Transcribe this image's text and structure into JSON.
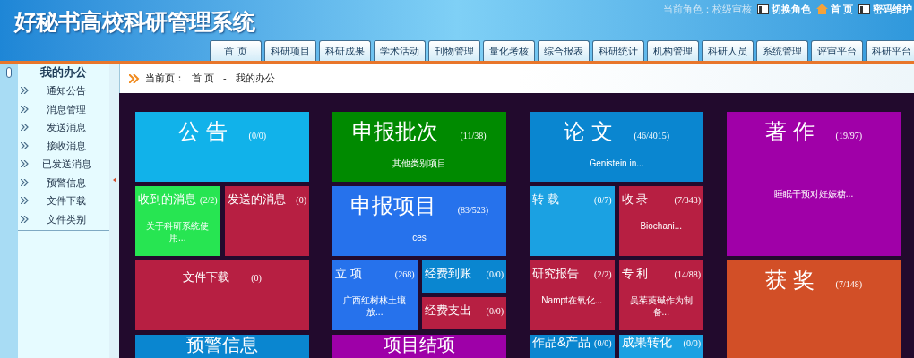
{
  "header": {
    "title": "好秘书高校科研管理系统",
    "role_label": "当前角色：校级审核",
    "links": [
      {
        "kind": "card",
        "label": "切换角色"
      },
      {
        "kind": "home",
        "label": "首 页"
      },
      {
        "kind": "card",
        "label": "密码维护"
      }
    ]
  },
  "nav_tabs": [
    {
      "label": "首 页"
    },
    {
      "label": "科研项目"
    },
    {
      "label": "科研成果"
    },
    {
      "label": "学术活动"
    },
    {
      "label": "刊物管理"
    },
    {
      "label": "量化考核"
    },
    {
      "label": "综合报表"
    },
    {
      "label": "科研统计"
    },
    {
      "label": "机构管理"
    },
    {
      "label": "科研人员"
    },
    {
      "label": "系统管理"
    },
    {
      "label": "评审平台"
    },
    {
      "label": "科研平台"
    }
  ],
  "sidebar": {
    "title": "我的办公",
    "items": [
      {
        "label": "通知公告"
      },
      {
        "label": "消息管理"
      },
      {
        "label": "发送消息"
      },
      {
        "label": "接收消息"
      },
      {
        "label": "已发送消息"
      },
      {
        "label": "预警信息"
      },
      {
        "label": "文件下载"
      },
      {
        "label": "文件类别"
      }
    ]
  },
  "breadcrumb": {
    "label": "当前页：",
    "items": [
      "首 页",
      "-",
      "我的办公"
    ]
  },
  "columns": [
    {
      "rows": [
        [
          [
            {
              "title": "公 告",
              "count": "(0/0)",
              "color": "#11b2ea"
            }
          ]
        ],
        [
          [
            {
              "title": "收到的消息",
              "count": "(2/2)",
              "subtitle": "关于科研系统使用...",
              "color": "#27e552"
            }
          ],
          [
            {
              "title": "发送的消息",
              "count": "(0)",
              "color": "#b71f42"
            }
          ]
        ],
        [
          [
            {
              "title": "文件下载",
              "count": "(0)",
              "color": "#b71f42",
              "small": true
            }
          ]
        ],
        [
          [
            {
              "title": "预警信息",
              "color": "#0a86d0"
            }
          ]
        ]
      ]
    },
    {
      "rows": [
        [
          [
            {
              "title": "申报批次",
              "count": "(11/38)",
              "subtitle": "其他类别项目",
              "color": "#008a00"
            }
          ]
        ],
        [
          [
            {
              "title": "申报项目",
              "count": "(83/523)",
              "subtitle": "ces",
              "color": "#2672ec"
            }
          ]
        ],
        [
          [
            {
              "title": "立 项",
              "count": "(268)",
              "subtitle": "广西红树林土壤放...",
              "color": "#2672ec"
            }
          ],
          [
            {
              "title": "经费到账",
              "count": "(0/0)",
              "color": "#0a86d0"
            },
            {
              "title": "经费支出",
              "count": "(0/0)",
              "color": "#b71f42"
            }
          ]
        ],
        [
          [
            {
              "title": "项目结项",
              "color": "#9e00a8"
            }
          ]
        ]
      ]
    },
    {
      "rows": [
        [
          [
            {
              "title": "论 文",
              "count": "(46/4015)",
              "subtitle": "Genistein in...",
              "color": "#0a86d0"
            }
          ]
        ],
        [
          [
            {
              "title": "转 载",
              "count": "(0/7)",
              "color": "#1ba1e2"
            }
          ],
          [
            {
              "title": "收 录",
              "count": "(7/343)",
              "subtitle": "Biochani...",
              "color": "#b71f42"
            }
          ]
        ],
        [
          [
            {
              "title": "研究报告",
              "count": "(2/2)",
              "subtitle": "Nampt在氧化...",
              "color": "#b71f42"
            }
          ],
          [
            {
              "title": "专 利",
              "count": "(14/88)",
              "subtitle": "吴茱萸碱作为制备...",
              "color": "#b71f42"
            }
          ]
        ],
        [
          [
            {
              "title": "作品&产品",
              "count": "(0/0)",
              "color": "#0a86d0"
            }
          ],
          [
            {
              "title": "成果转化",
              "count": "(0/0)",
              "color": "#1ba1e2"
            }
          ]
        ]
      ]
    },
    {
      "rows": [
        [
          [
            {
              "title": "著 作",
              "count": "(19/97)",
              "subtitle": "睡眠干预对妊娠糖...",
              "color": "#a000a8",
              "tall": true
            }
          ]
        ],
        [
          [
            {
              "title": "获 奖",
              "count": "(7/148)",
              "color": "#d24f27",
              "tall": true
            }
          ]
        ]
      ]
    }
  ]
}
